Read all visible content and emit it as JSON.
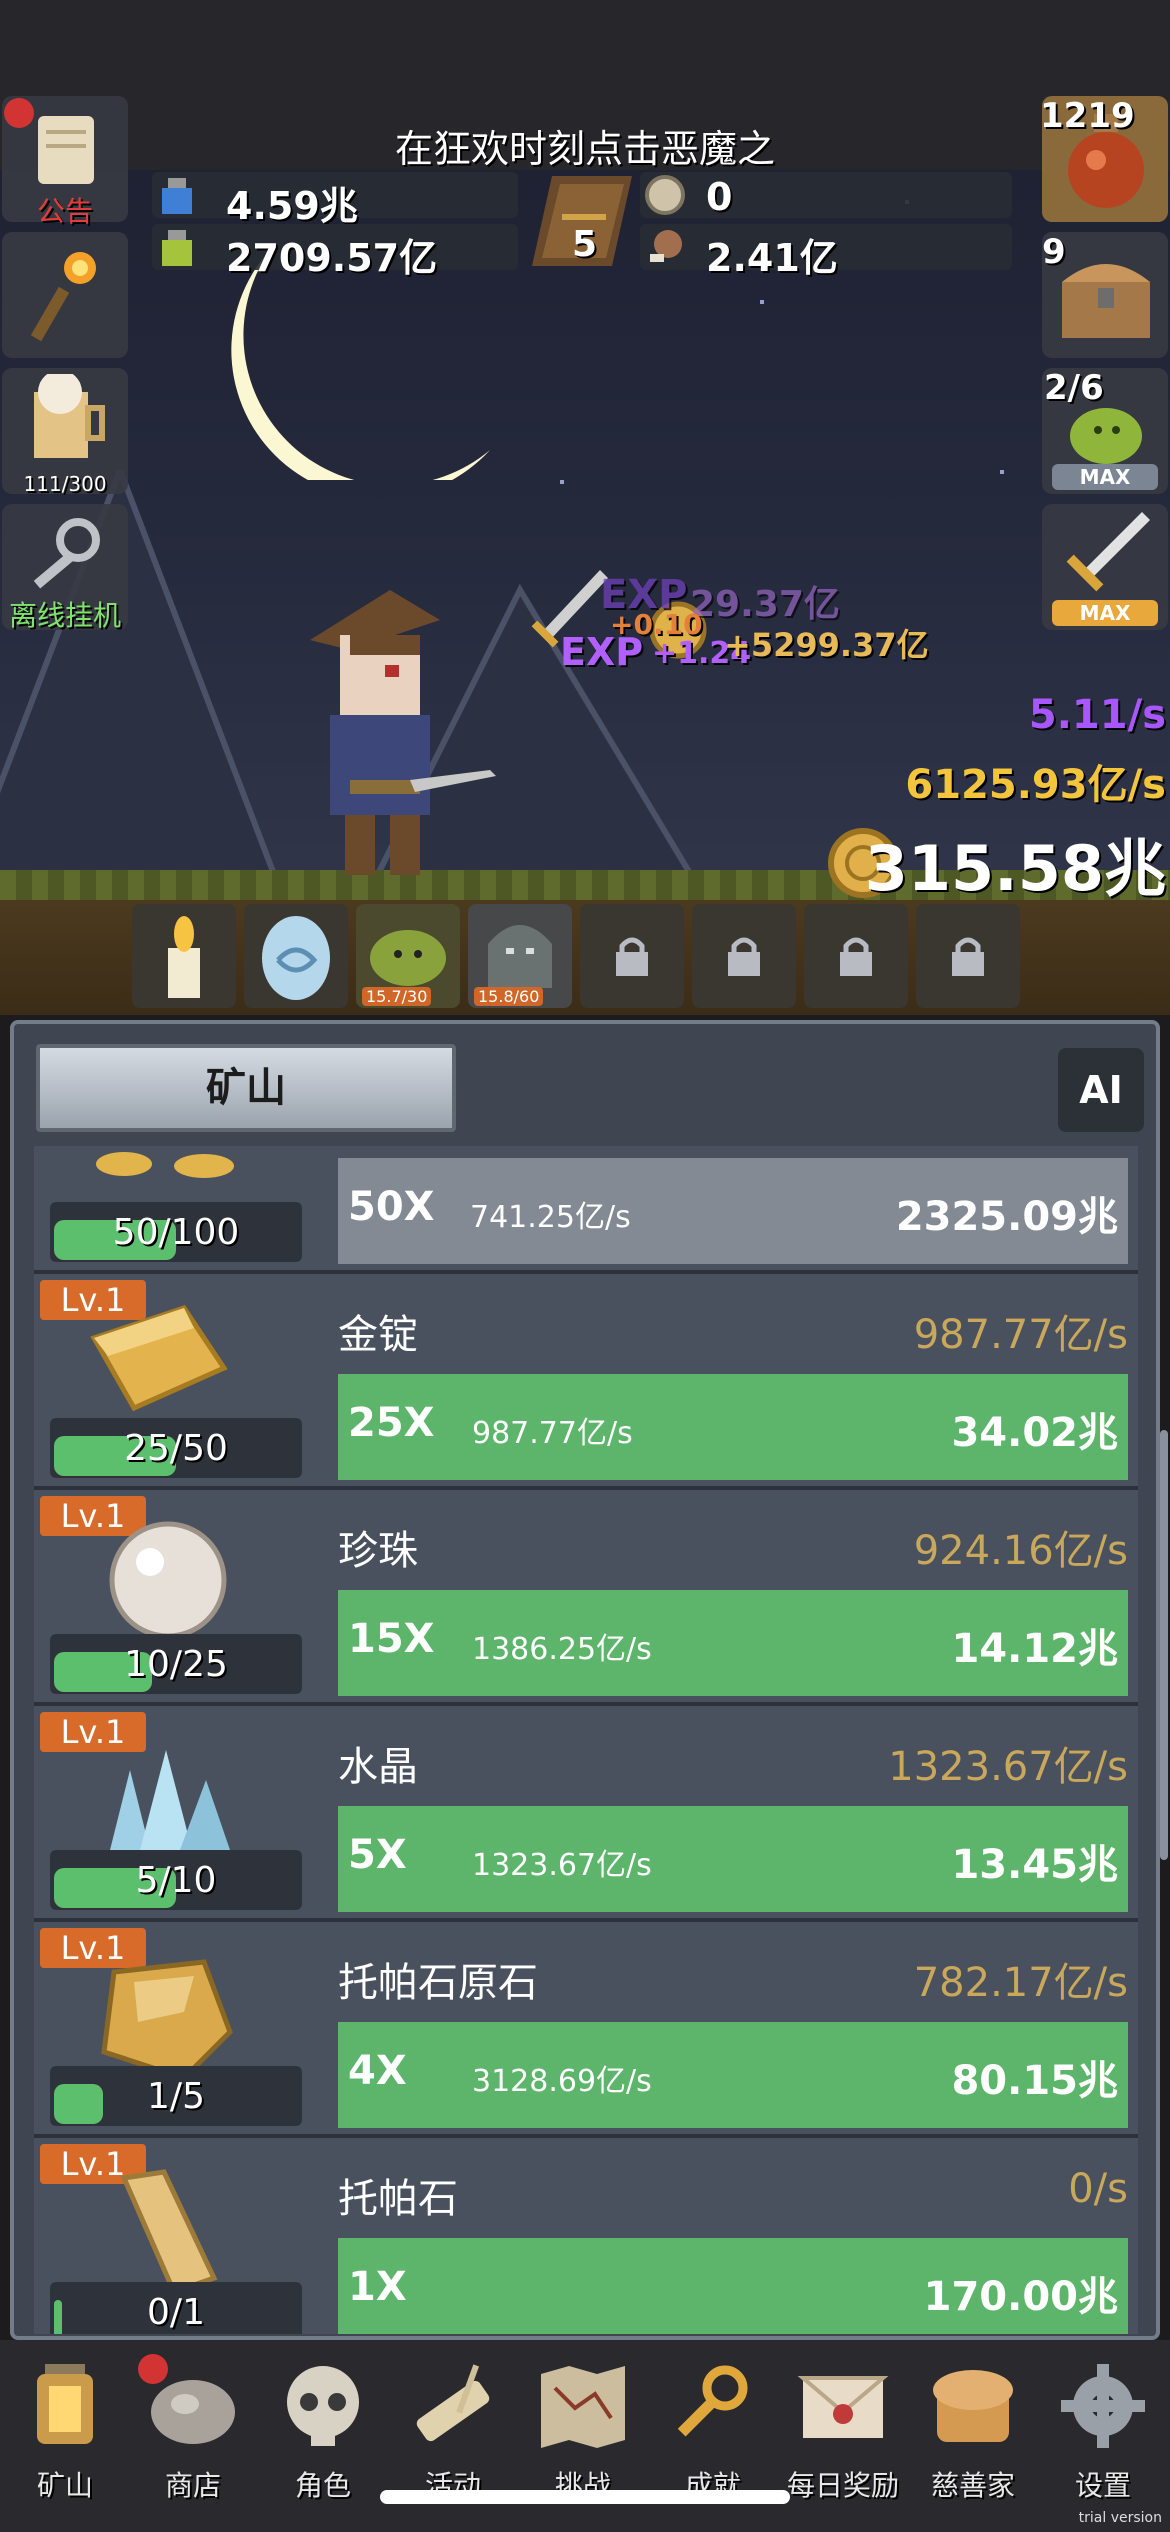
{
  "scene": {
    "event_text": "在狂欢时刻点击恶魔之",
    "currencies": {
      "blue_potion": "4.59兆",
      "green_potion": "2709.57亿",
      "book_count": "5",
      "coin_gray": "0",
      "meat": "2.41亿"
    },
    "left_buttons": [
      {
        "label": "公告",
        "icon": "scroll-icon",
        "has_dot": true
      },
      {
        "label": "",
        "icon": "torch-icon"
      },
      {
        "label": "111/300",
        "icon": "beer-mug-icon"
      },
      {
        "label": "离线挂机",
        "icon": "key-icon"
      }
    ],
    "right_buttons": [
      {
        "count": "1219",
        "icon": "potion-icon"
      },
      {
        "count": "9",
        "icon": "chest-icon"
      },
      {
        "count": "2/6",
        "icon": "slime-icon",
        "tag": "MAX"
      },
      {
        "count": "",
        "icon": "sword-icon",
        "tag": "MAX"
      }
    ],
    "floating": {
      "exp_a": "EXP",
      "exp_b": "EXP",
      "gold_a": "+5299.37亿",
      "gold_b": "29.37亿",
      "small_a": "+0.10",
      "small_b": "+1.24"
    },
    "exp_rate": "5.11/s",
    "gold_rate": "6125.93亿/s",
    "total_gold": "315.58兆",
    "pets": [
      {
        "icon": "candle-icon",
        "badge": ""
      },
      {
        "icon": "egg-icon",
        "badge": ""
      },
      {
        "icon": "slime-pet-icon",
        "badge": "15.7/30"
      },
      {
        "icon": "ghost-pet-icon",
        "badge": "15.8/60"
      },
      {
        "icon": "lock-icon",
        "badge": ""
      },
      {
        "icon": "lock-icon",
        "badge": ""
      },
      {
        "icon": "lock-icon",
        "badge": ""
      },
      {
        "icon": "lock-icon",
        "badge": ""
      }
    ]
  },
  "panel": {
    "tab_label": "矿山",
    "ai_label": "AI",
    "rows": [
      {
        "lv": "",
        "name": "",
        "rate": "",
        "progress_text": "50/100",
        "progress": 0.5,
        "mult": "50X",
        "buy_rate": "741.25亿/s",
        "cost": "2325.09兆",
        "icon": "gold-coins-icon",
        "disabled": true
      },
      {
        "lv": "Lv.1",
        "name": "金锭",
        "rate": "987.77亿/s",
        "progress_text": "25/50",
        "progress": 0.5,
        "mult": "25X",
        "buy_rate": "987.77亿/s",
        "cost": "34.02兆",
        "icon": "gold-ingot-icon"
      },
      {
        "lv": "Lv.1",
        "name": "珍珠",
        "rate": "924.16亿/s",
        "progress_text": "10/25",
        "progress": 0.4,
        "mult": "15X",
        "buy_rate": "1386.25亿/s",
        "cost": "14.12兆",
        "icon": "pearl-icon"
      },
      {
        "lv": "Lv.1",
        "name": "水晶",
        "rate": "1323.67亿/s",
        "progress_text": "5/10",
        "progress": 0.5,
        "mult": "5X",
        "buy_rate": "1323.67亿/s",
        "cost": "13.45兆",
        "icon": "crystal-icon"
      },
      {
        "lv": "Lv.1",
        "name": "托帕石原石",
        "rate": "782.17亿/s",
        "progress_text": "1/5",
        "progress": 0.2,
        "mult": "4X",
        "buy_rate": "3128.69亿/s",
        "cost": "80.15兆",
        "icon": "topaz-ore-icon"
      },
      {
        "lv": "Lv.1",
        "name": "托帕石",
        "rate": "0/s",
        "progress_text": "0/1",
        "progress": 0.0,
        "mult": "1X",
        "buy_rate": "",
        "cost": "170.00兆",
        "icon": "topaz-bar-icon"
      }
    ]
  },
  "nav": [
    {
      "label": "矿山",
      "icon": "lantern-icon"
    },
    {
      "label": "商店",
      "icon": "stone-icon",
      "has_dot": true
    },
    {
      "label": "角色",
      "icon": "skull-icon"
    },
    {
      "label": "活动",
      "icon": "scroll-quill-icon"
    },
    {
      "label": "挑战",
      "icon": "map-icon"
    },
    {
      "label": "成就",
      "icon": "golden-key-icon"
    },
    {
      "label": "每日奖励",
      "icon": "letter-icon"
    },
    {
      "label": "慈善家",
      "icon": "bread-icon"
    },
    {
      "label": "设置",
      "icon": "gear-icon"
    }
  ],
  "trial_text": "trial version"
}
